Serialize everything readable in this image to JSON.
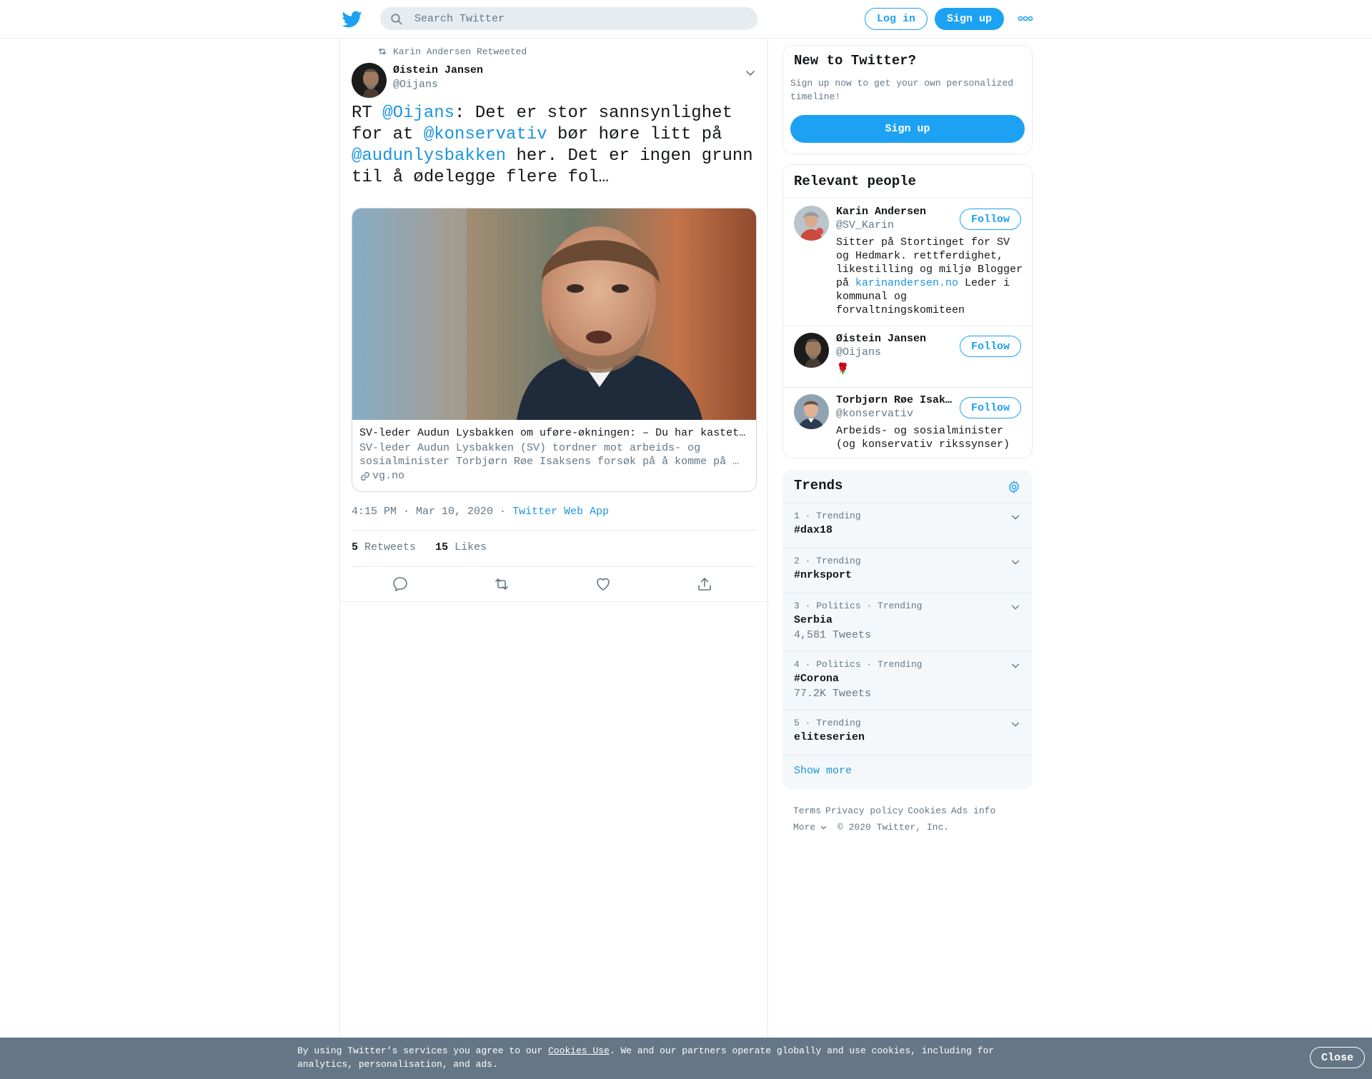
{
  "header": {
    "search_placeholder": "Search Twitter",
    "login_label": "Log in",
    "signup_label": "Sign up",
    "brand_color": "#1da1f2"
  },
  "tweet": {
    "retweeted_by": "Karin Andersen Retweeted",
    "author_name": "Øistein Jansen",
    "author_handle": "@Oijans",
    "text_parts": {
      "p1": "RT ",
      "m1": "@Oijans",
      "p2": ": Det er stor sannsynlighet for at ",
      "m2": "@konservativ",
      "p3": " bør høre litt på ",
      "m3": "@audunlysbakken",
      "p4": " her. Det er ingen grunn til å ødelegge flere fol…"
    },
    "card": {
      "title": "SV-leder Audun Lysbakken om uføre-økningen: – Du har kastet…",
      "description": "SV-leder Audun Lysbakken (SV) tordner mot arbeids- og sosialminister Torbjørn Røe Isaksens forsøk på å komme på …",
      "domain": "vg.no"
    },
    "timestamp": "4:15 PM · Mar 10, 2020",
    "meta_sep": " · ",
    "source": "Twitter Web App",
    "retweets_count": "5",
    "retweets_label": "Retweets",
    "likes_count": "15",
    "likes_label": "Likes"
  },
  "sidebar": {
    "new_to_twitter": {
      "title": "New to Twitter?",
      "subtitle": "Sign up now to get your own personalized timeline!",
      "signup_label": "Sign up"
    },
    "relevant_people": {
      "title": "Relevant people",
      "people": [
        {
          "name": "Karin Andersen",
          "handle": "@SV_Karin",
          "follow_label": "Follow",
          "bio_pre": "Sitter på Stortinget for SV og Hedmark. rettferdighet, likestilling og miljø Blogger på ",
          "bio_link": "karinandersen.no",
          "bio_post": " Leder i kommunal og forvaltningskomiteen"
        },
        {
          "name": "Øistein Jansen",
          "handle": "@Oijans",
          "follow_label": "Follow",
          "bio": "🌹"
        },
        {
          "name": "Torbjørn Røe Isaksen",
          "handle": "@konservativ",
          "follow_label": "Follow",
          "bio": "Arbeids- og sosialminister (og konservativ rikssynser)"
        }
      ]
    },
    "trends": {
      "title": "Trends",
      "items": [
        {
          "meta": "1 · Trending",
          "name": "#dax18",
          "count": ""
        },
        {
          "meta": "2 · Trending",
          "name": "#nrksport",
          "count": ""
        },
        {
          "meta": "3 · Politics · Trending",
          "name": "Serbia",
          "count": "4,581 Tweets"
        },
        {
          "meta": "4 · Politics · Trending",
          "name": "#Corona",
          "count": "77.2K Tweets"
        },
        {
          "meta": "5 · Trending",
          "name": "eliteserien",
          "count": ""
        }
      ],
      "show_more": "Show more"
    },
    "footer": {
      "terms": "Terms",
      "privacy": "Privacy policy",
      "cookies": "Cookies",
      "ads": "Ads info",
      "more": "More",
      "copyright": "© 2020 Twitter, Inc."
    }
  },
  "cookie_bar": {
    "text_pre": "By using Twitter’s services you agree to our ",
    "link": "Cookies Use",
    "text_post": ". We and our partners operate globally and use cookies, including for analytics, personalisation, and ads.",
    "close_label": "Close"
  }
}
